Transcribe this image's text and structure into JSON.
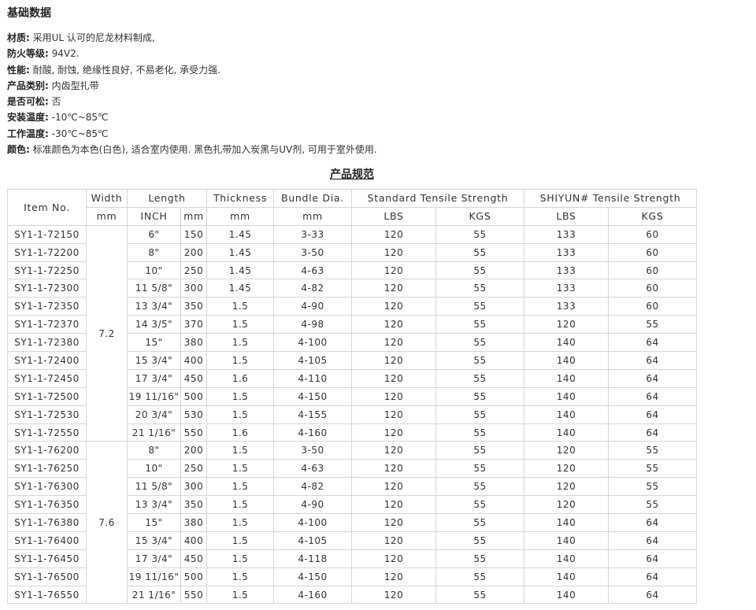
{
  "basic": {
    "title": "基础数据",
    "props": [
      {
        "key": "材质:",
        "value": "采用UL 认可的尼龙材料制成,"
      },
      {
        "key": "防火等级:",
        "value": "94V2."
      },
      {
        "key": "性能:",
        "value": "耐酸, 耐蚀, 绝缘性良好, 不易老化, 承受力强."
      },
      {
        "key": "产品类别:",
        "value": "内齿型扎带"
      },
      {
        "key": "是否可松:",
        "value": "否"
      },
      {
        "key": "安装温度:",
        "value": "-10℃~85℃"
      },
      {
        "key": "工作温度:",
        "value": "-30℃~85℃"
      },
      {
        "key": "颜色:",
        "value": "标准颜色为本色(白色), 适合室内使用. 黑色扎带加入炭黑与UV剂, 可用于室外使用."
      }
    ]
  },
  "spec": {
    "title": "产品规范",
    "headers": {
      "item_no": "Item No.",
      "width": "Width",
      "length": "Length",
      "thickness": "Thickness",
      "bundle": "Bundle Dia.",
      "std": "Standard Tensile Strength",
      "shiyun": "SHIYUN# Tensile Strength",
      "mm1": "mm",
      "inch": "INCH",
      "mm2": "mm",
      "mm3": "mm",
      "mm4": "mm",
      "lbs1": "LBS",
      "kgs1": "KGS",
      "lbs2": "LBS",
      "kgs2": "KGS"
    },
    "groups": [
      {
        "width": "7.2",
        "rows": [
          [
            "SY1-1-72150",
            "6\"",
            "150",
            "1.45",
            "3-33",
            "120",
            "55",
            "133",
            "60"
          ],
          [
            "SY1-1-72200",
            "8\"",
            "200",
            "1.45",
            "3-50",
            "120",
            "55",
            "133",
            "60"
          ],
          [
            "SY1-1-72250",
            "10\"",
            "250",
            "1.45",
            "4-63",
            "120",
            "55",
            "133",
            "60"
          ],
          [
            "SY1-1-72300",
            "11 5/8\"",
            "300",
            "1.45",
            "4-82",
            "120",
            "55",
            "133",
            "60"
          ],
          [
            "SY1-1-72350",
            "13 3/4\"",
            "350",
            "1.5",
            "4-90",
            "120",
            "55",
            "133",
            "60"
          ],
          [
            "SY1-1-72370",
            "14 3/5\"",
            "370",
            "1.5",
            "4-98",
            "120",
            "55",
            "120",
            "55"
          ],
          [
            "SY1-1-72380",
            "15\"",
            "380",
            "1.5",
            "4-100",
            "120",
            "55",
            "140",
            "64"
          ],
          [
            "SY1-1-72400",
            "15 3/4\"",
            "400",
            "1.5",
            "4-105",
            "120",
            "55",
            "140",
            "64"
          ],
          [
            "SY1-1-72450",
            "17 3/4\"",
            "450",
            "1.6",
            "4-110",
            "120",
            "55",
            "140",
            "64"
          ],
          [
            "SY1-1-72500",
            "19 11/16\"",
            "500",
            "1.5",
            "4-150",
            "120",
            "55",
            "140",
            "64"
          ],
          [
            "SY1-1-72530",
            "20 3/4\"",
            "530",
            "1.5",
            "4-155",
            "120",
            "55",
            "140",
            "64"
          ],
          [
            "SY1-1-72550",
            "21 1/16\"",
            "550",
            "1.6",
            "4-160",
            "120",
            "55",
            "140",
            "64"
          ]
        ]
      },
      {
        "width": "7.6",
        "rows": [
          [
            "SY1-1-76200",
            "8\"",
            "200",
            "1.5",
            "3-50",
            "120",
            "55",
            "120",
            "55"
          ],
          [
            "SY1-1-76250",
            "10\"",
            "250",
            "1.5",
            "4-63",
            "120",
            "55",
            "120",
            "55"
          ],
          [
            "SY1-1-76300",
            "11 5/8\"",
            "300",
            "1.5",
            "4-82",
            "120",
            "55",
            "120",
            "55"
          ],
          [
            "SY1-1-76350",
            "13 3/4\"",
            "350",
            "1.5",
            "4-90",
            "120",
            "55",
            "120",
            "55"
          ],
          [
            "SY1-1-76380",
            "15\"",
            "380",
            "1.5",
            "4-100",
            "120",
            "55",
            "140",
            "64"
          ],
          [
            "SY1-1-76400",
            "15 3/4\"",
            "400",
            "1.5",
            "4-105",
            "120",
            "55",
            "140",
            "64"
          ],
          [
            "SY1-1-76450",
            "17 3/4\"",
            "450",
            "1.5",
            "4-118",
            "120",
            "55",
            "140",
            "64"
          ],
          [
            "SY1-1-76500",
            "19 11/16\"",
            "500",
            "1.5",
            "4-150",
            "120",
            "55",
            "140",
            "64"
          ],
          [
            "SY1-1-76550",
            "21 1/16\"",
            "550",
            "1.5",
            "4-160",
            "120",
            "55",
            "140",
            "64"
          ]
        ]
      }
    ]
  }
}
